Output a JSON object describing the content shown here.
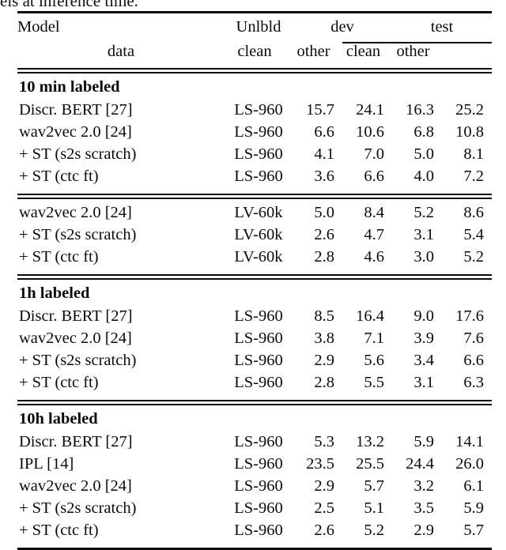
{
  "caption_fragment": "els at inference time.",
  "table": {
    "header": {
      "model": "Model",
      "unlbld_line1": "Unlbld",
      "unlbld_line2": "data",
      "groups": [
        {
          "name": "dev",
          "subcols": [
            "clean",
            "other"
          ]
        },
        {
          "name": "test",
          "subcols": [
            "clean",
            "other"
          ]
        }
      ]
    },
    "sections": [
      {
        "title": "10 min labeled",
        "has_title": true,
        "rows": [
          {
            "model": "Discr. BERT [27]",
            "indent": false,
            "unlbld": "LS-960",
            "dev_clean": "15.7",
            "dev_other": "24.1",
            "test_clean": "16.3",
            "test_other": "25.2"
          },
          {
            "model": "wav2vec 2.0 [24]",
            "indent": false,
            "unlbld": "LS-960",
            "dev_clean": "6.6",
            "dev_other": "10.6",
            "test_clean": "6.8",
            "test_other": "10.8"
          },
          {
            "model": "+ ST (s2s scratch)",
            "indent": true,
            "unlbld": "LS-960",
            "dev_clean": "4.1",
            "dev_other": "7.0",
            "test_clean": "5.0",
            "test_other": "8.1"
          },
          {
            "model": "+ ST (ctc ft)",
            "indent": true,
            "unlbld": "LS-960",
            "dev_clean": "3.6",
            "dev_other": "6.6",
            "test_clean": "4.0",
            "test_other": "7.2"
          }
        ]
      },
      {
        "title": "",
        "has_title": false,
        "rows": [
          {
            "model": "wav2vec 2.0 [24]",
            "indent": false,
            "unlbld": "LV-60k",
            "dev_clean": "5.0",
            "dev_other": "8.4",
            "test_clean": "5.2",
            "test_other": "8.6"
          },
          {
            "model": "+ ST (s2s scratch)",
            "indent": true,
            "unlbld": "LV-60k",
            "dev_clean": "2.6",
            "dev_other": "4.7",
            "test_clean": "3.1",
            "test_other": "5.4"
          },
          {
            "model": "+ ST (ctc ft)",
            "indent": true,
            "unlbld": "LV-60k",
            "dev_clean": "2.8",
            "dev_other": "4.6",
            "test_clean": "3.0",
            "test_other": "5.2"
          }
        ]
      },
      {
        "title": "1h labeled",
        "has_title": true,
        "rows": [
          {
            "model": "Discr. BERT [27]",
            "indent": false,
            "unlbld": "LS-960",
            "dev_clean": "8.5",
            "dev_other": "16.4",
            "test_clean": "9.0",
            "test_other": "17.6"
          },
          {
            "model": "wav2vec 2.0 [24]",
            "indent": false,
            "unlbld": "LS-960",
            "dev_clean": "3.8",
            "dev_other": "7.1",
            "test_clean": "3.9",
            "test_other": "7.6"
          },
          {
            "model": "+ ST (s2s scratch)",
            "indent": true,
            "unlbld": "LS-960",
            "dev_clean": "2.9",
            "dev_other": "5.6",
            "test_clean": "3.4",
            "test_other": "6.6"
          },
          {
            "model": "+ ST (ctc ft)",
            "indent": true,
            "unlbld": "LS-960",
            "dev_clean": "2.8",
            "dev_other": "5.5",
            "test_clean": "3.1",
            "test_other": "6.3"
          }
        ]
      },
      {
        "title": "10h labeled",
        "has_title": true,
        "rows": [
          {
            "model": "Discr. BERT [27]",
            "indent": false,
            "unlbld": "LS-960",
            "dev_clean": "5.3",
            "dev_other": "13.2",
            "test_clean": "5.9",
            "test_other": "14.1"
          },
          {
            "model": "IPL [14]",
            "indent": false,
            "unlbld": "LS-960",
            "dev_clean": "23.5",
            "dev_other": "25.5",
            "test_clean": "24.4",
            "test_other": "26.0"
          },
          {
            "model": "wav2vec 2.0 [24]",
            "indent": false,
            "unlbld": "LS-960",
            "dev_clean": "2.9",
            "dev_other": "5.7",
            "test_clean": "3.2",
            "test_other": "6.1"
          },
          {
            "model": "+ ST (s2s scratch)",
            "indent": true,
            "unlbld": "LS-960",
            "dev_clean": "2.5",
            "dev_other": "5.1",
            "test_clean": "3.5",
            "test_other": "5.9"
          },
          {
            "model": "+ ST (ctc ft)",
            "indent": true,
            "unlbld": "LS-960",
            "dev_clean": "2.6",
            "dev_other": "5.2",
            "test_clean": "2.9",
            "test_other": "5.7"
          }
        ]
      }
    ]
  }
}
